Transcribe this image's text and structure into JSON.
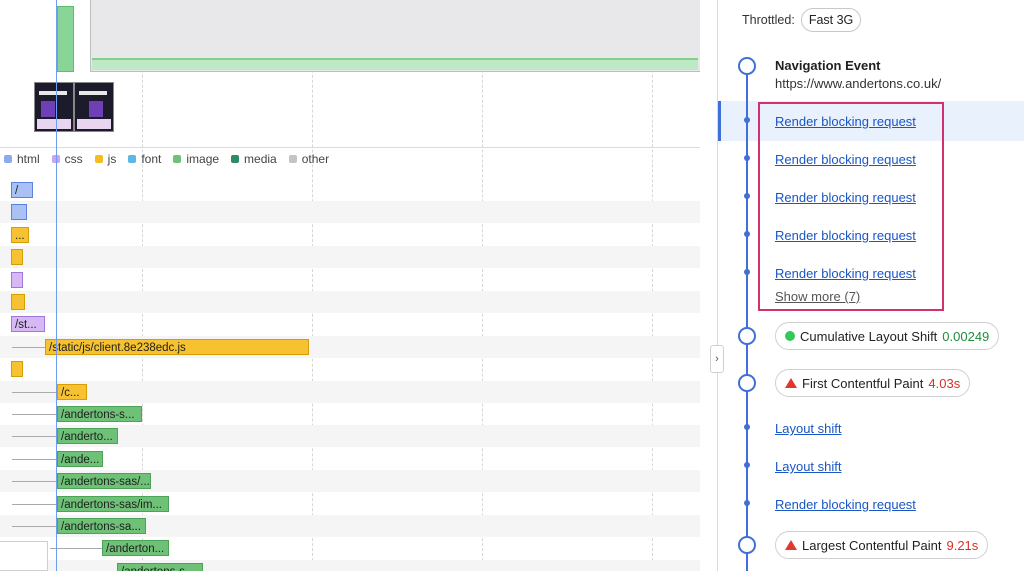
{
  "legend": [
    {
      "label": "html",
      "color": "#8fa9ef"
    },
    {
      "label": "css",
      "color": "#c9a3f2"
    },
    {
      "label": "js",
      "color": "#f4bd1e"
    },
    {
      "label": "font",
      "color": "#5fb7e6"
    },
    {
      "label": "image",
      "color": "#6ec177"
    },
    {
      "label": "media",
      "color": "#2e8b63"
    },
    {
      "label": "other",
      "color": "#c4c4c4"
    }
  ],
  "requests": [
    {
      "label": "/",
      "type": "html"
    },
    {
      "label": "",
      "type": "html"
    },
    {
      "label": "...",
      "type": "js"
    },
    {
      "label": "",
      "type": "js"
    },
    {
      "label": "",
      "type": "css"
    },
    {
      "label": "",
      "type": "js"
    },
    {
      "label": "/st...",
      "type": "css"
    },
    {
      "label": "/static/js/client.8e238edc.js",
      "type": "js"
    },
    {
      "label": "",
      "type": "js"
    },
    {
      "label": "/c...",
      "type": "js"
    },
    {
      "label": "/andertons-s...",
      "type": "image"
    },
    {
      "label": "/anderto...",
      "type": "image"
    },
    {
      "label": "/ande...",
      "type": "image"
    },
    {
      "label": "/andertons-sas/...",
      "type": "image"
    },
    {
      "label": "/andertons-sas/im...",
      "type": "image"
    },
    {
      "label": "/andertons-sa...",
      "type": "image"
    },
    {
      "label": "/anderton...",
      "type": "image"
    },
    {
      "label": "/andertons-s...",
      "type": "image"
    }
  ],
  "collapse_glyph": "›",
  "sidebar": {
    "throttled_label": "Throttled:",
    "throttle_value": "Fast 3G",
    "nav_title": "Navigation Event",
    "nav_url": "https://www.andertons.co.uk/",
    "render_blocking": [
      "Render blocking request",
      "Render blocking request",
      "Render blocking request",
      "Render blocking request",
      "Render blocking request"
    ],
    "show_more": "Show more (7)",
    "cls_label": "Cumulative Layout Shift",
    "cls_value": "0.00249",
    "fcp_label": "First Contentful Paint",
    "fcp_value": "4.03s",
    "layout_shift_1": "Layout shift",
    "layout_shift_2": "Layout shift",
    "render_blocking_extra": "Render blocking request",
    "lcp_label": "Largest Contentful Paint",
    "lcp_value": "9.21s"
  }
}
